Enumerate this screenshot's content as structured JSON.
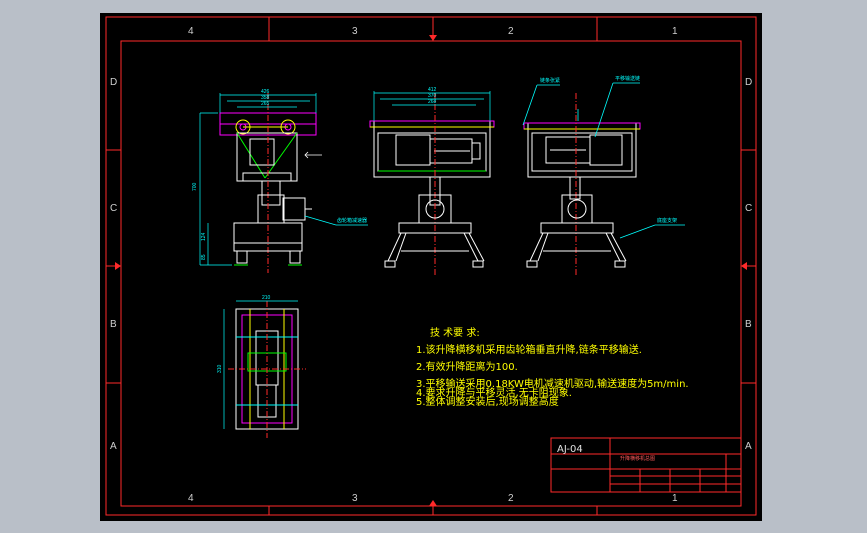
{
  "zones": {
    "top": [
      "4",
      "3",
      "2",
      "1"
    ],
    "bottom": [
      "4",
      "3",
      "2",
      "1"
    ],
    "left": [
      "D",
      "C",
      "B",
      "A"
    ],
    "right": [
      "D",
      "C",
      "B",
      "A"
    ]
  },
  "tech_notes": {
    "heading": "技 术要 求:",
    "lines": [
      "1.该升降横移机采用齿轮箱垂直升降,链条平移输送.",
      "2.有效升降距离为100.",
      "3.平移输送采用0.18KW电机减速机驱动,输送速度为5m/min.",
      "4.要求升降与平移灵活,无卡阻现象.",
      "5.整体调整安装后,现场调整高度"
    ]
  },
  "title_block": {
    "drawing_code": "AJ-04",
    "name": "升降横移机总图"
  },
  "callouts": [
    "链条张紧",
    "平移输送链",
    "齿轮箱减速器",
    "底座支架"
  ],
  "dimensions": {
    "top_width": [
      "426",
      "358",
      "265"
    ],
    "front_width": [
      "412",
      "370",
      "268"
    ],
    "height": "700",
    "base": "124",
    "foot": "85",
    "plan_width": "210",
    "plan_height": "310"
  },
  "colors": {
    "background": "#000000",
    "frame": "#ff2a2a",
    "geometry": "#ffffff",
    "dimension": "#00ffff",
    "notes": "#ffff00",
    "magenta": "#ff00ff",
    "green": "#00ff00"
  }
}
